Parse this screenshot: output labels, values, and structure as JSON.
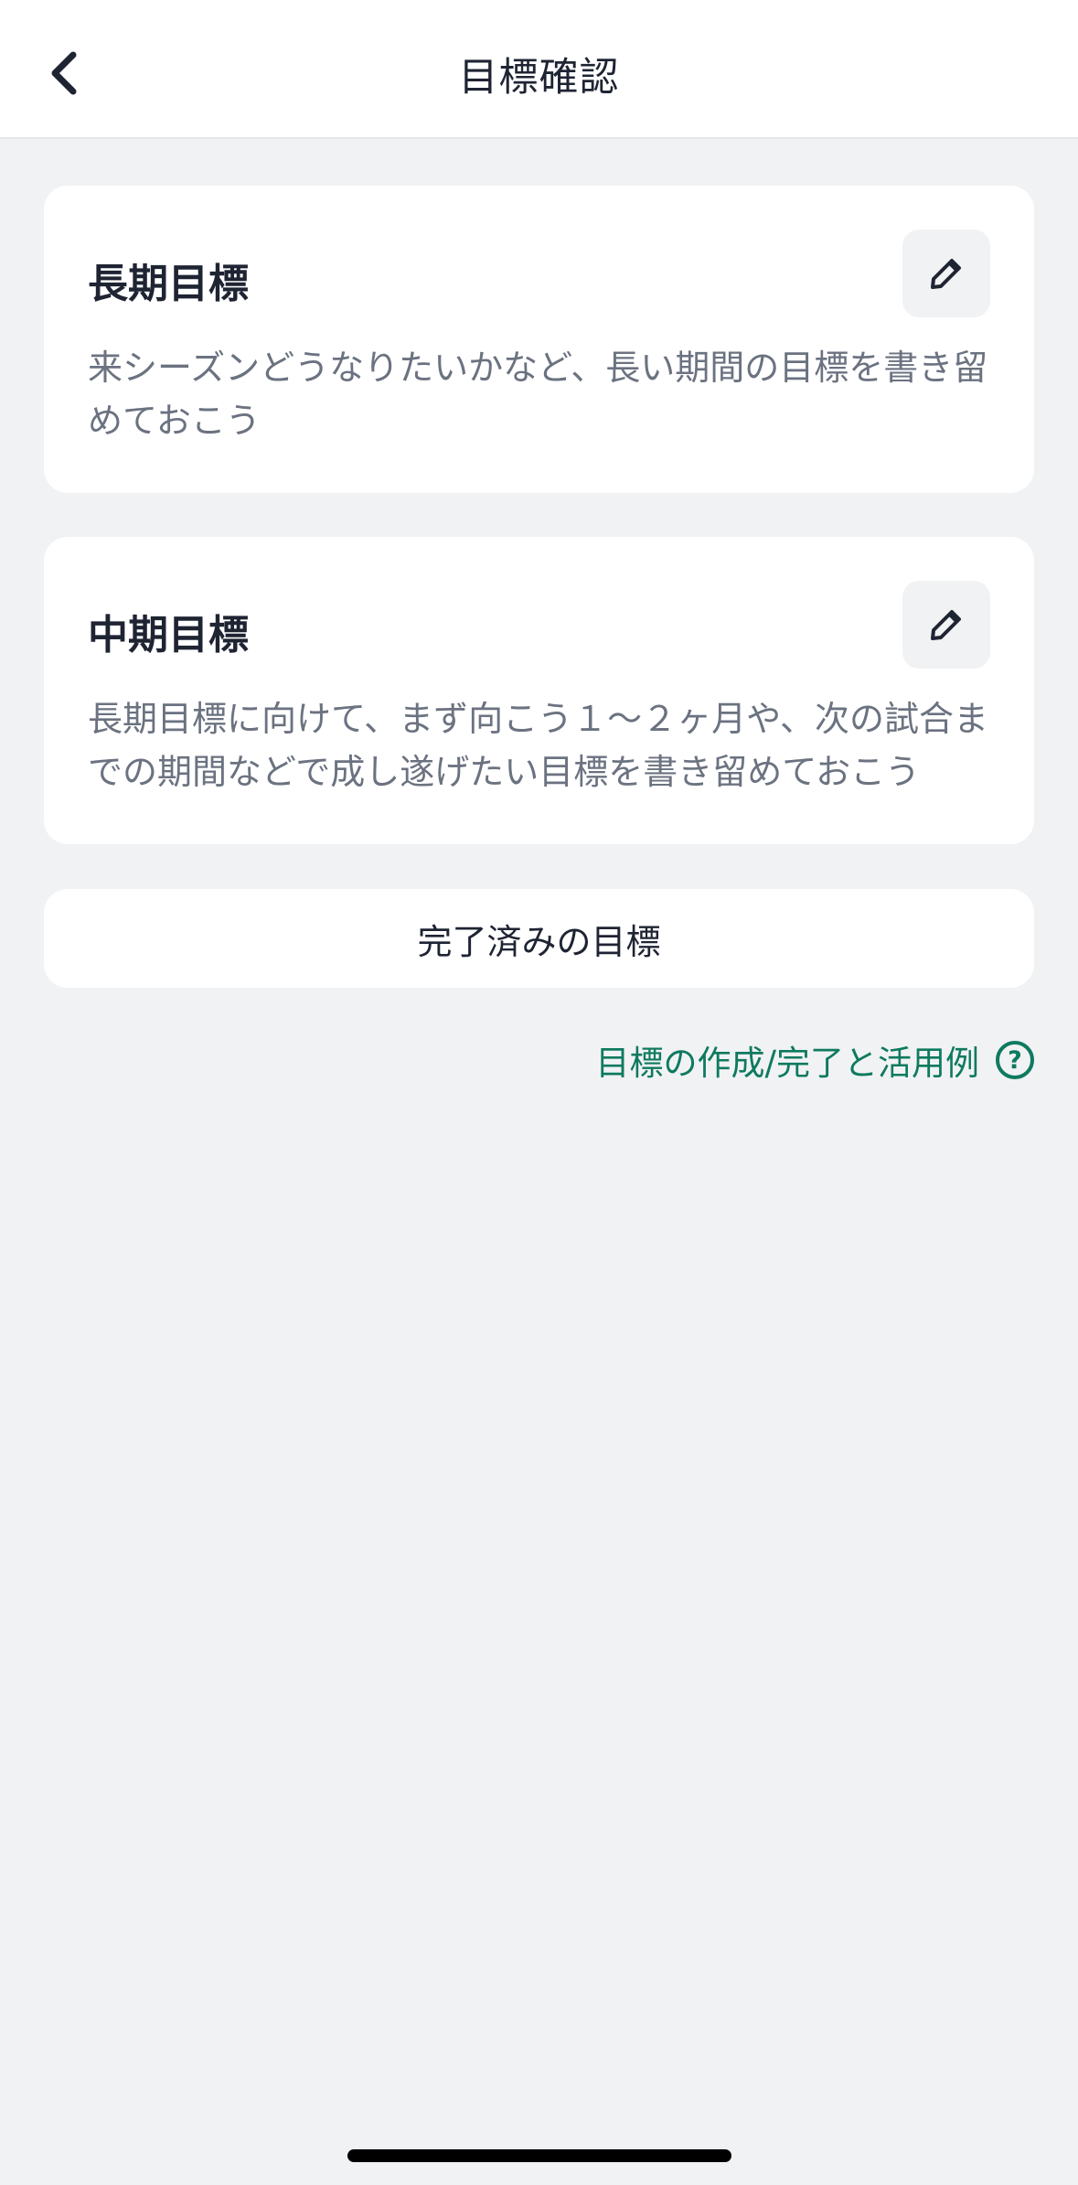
{
  "header": {
    "title": "目標確認"
  },
  "cards": [
    {
      "title": "長期目標",
      "description": "来シーズンどうなりたいかなど、長い期間の目標を書き留めておこう"
    },
    {
      "title": "中期目標",
      "description": "長期目標に向けて、まず向こう１〜２ヶ月や、次の試合までの期間などで成し遂げたい目標を書き留めておこう"
    }
  ],
  "completed_button": {
    "label": "完了済みの目標"
  },
  "help_link": {
    "label": "目標の作成/完了と活用例",
    "icon_glyph": "?"
  },
  "icons": {
    "back": "chevron-left-icon",
    "edit": "pencil-icon",
    "help": "question-circle-icon"
  },
  "colors": {
    "background": "#f1f2f4",
    "card": "#ffffff",
    "text_primary": "#1f2433",
    "text_secondary": "#6b7280",
    "accent_green": "#0e7a5f"
  }
}
